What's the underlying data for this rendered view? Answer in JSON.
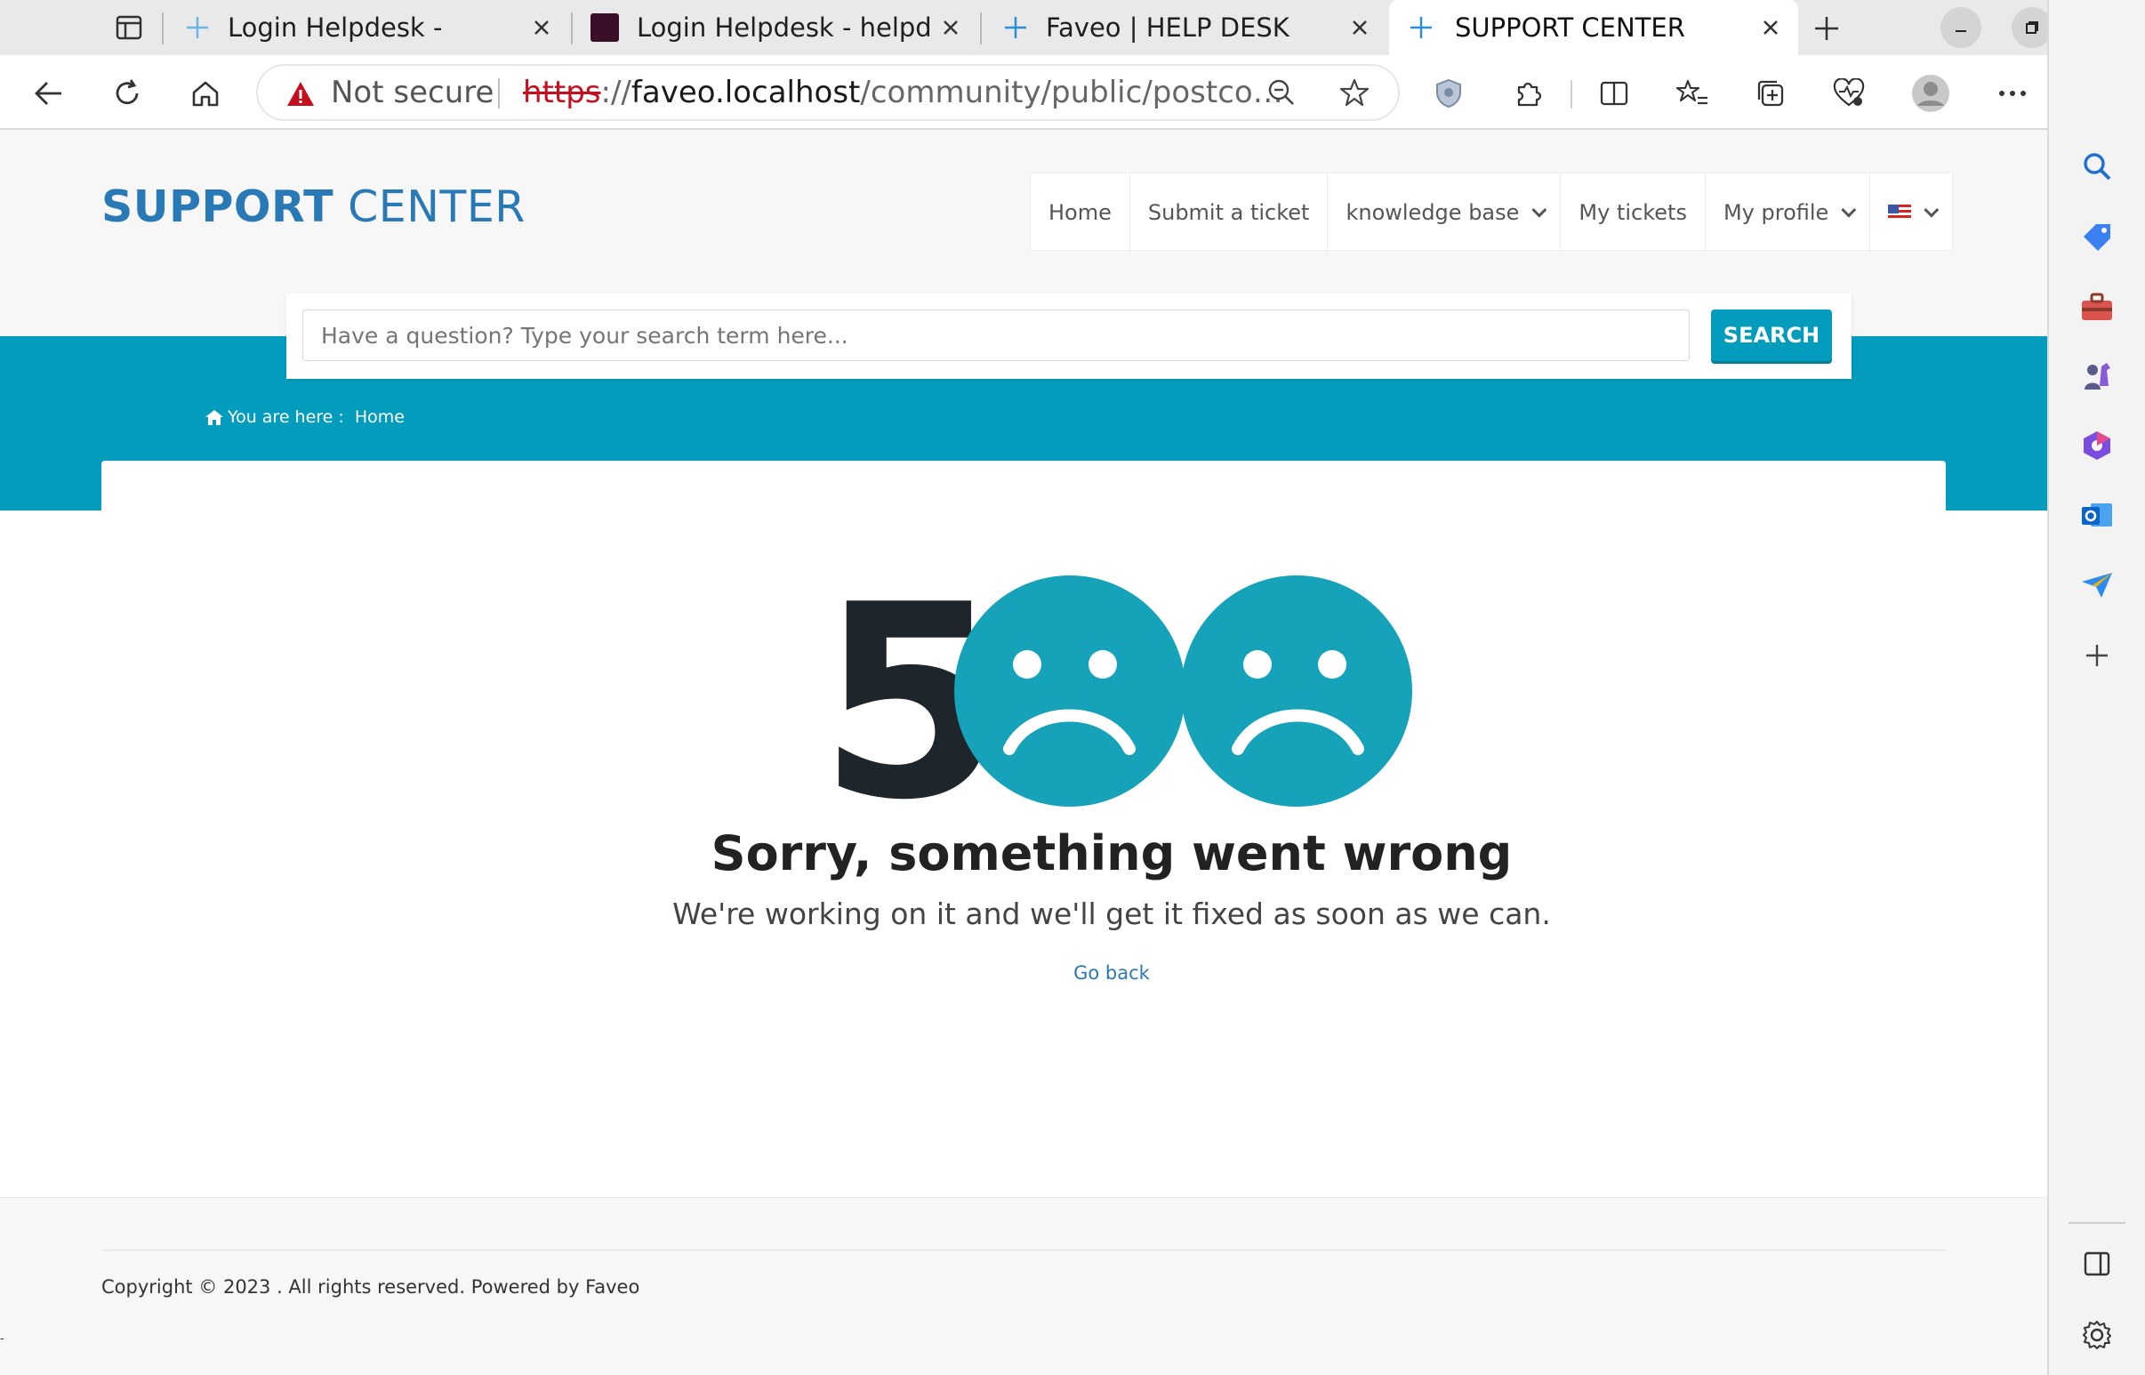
{
  "browser": {
    "tabs": [
      {
        "title": "Login Helpdesk -",
        "active": false
      },
      {
        "title": "Login Helpdesk - helpde",
        "active": false
      },
      {
        "title": "Faveo | HELP DESK",
        "active": false
      },
      {
        "title": "SUPPORT CENTER",
        "active": true
      }
    ],
    "address": {
      "security_label": "Not secure",
      "scheme": "https",
      "separator": "://",
      "host": "faveo.localhost",
      "path": "/community/public/postco…"
    }
  },
  "site": {
    "brand": {
      "strong": "SUPPORT",
      "light": " CENTER"
    },
    "nav": {
      "home": "Home",
      "submit_ticket": "Submit a ticket",
      "knowledge_base": "knowledge base",
      "my_tickets": "My tickets",
      "my_profile": "My profile"
    },
    "search": {
      "placeholder": "Have a question? Type your search term here...",
      "button": "SEARCH"
    },
    "breadcrumb": {
      "label": "You are here :",
      "home": "Home"
    },
    "error": {
      "code_digit": "5",
      "title": "Sorry, something went wrong",
      "subtitle": "We're working on it and we'll get it fixed as soon as we can.",
      "back_link": "Go back"
    },
    "footer": {
      "copyright": "Copyright © 2023 . All rights reserved. Powered by Faveo",
      "stray": "-"
    }
  },
  "colors": {
    "brand_blue": "#2a79b7",
    "banner_teal": "#039cbd",
    "face_teal": "#16a2b8",
    "warning_red": "#c50f1f"
  }
}
